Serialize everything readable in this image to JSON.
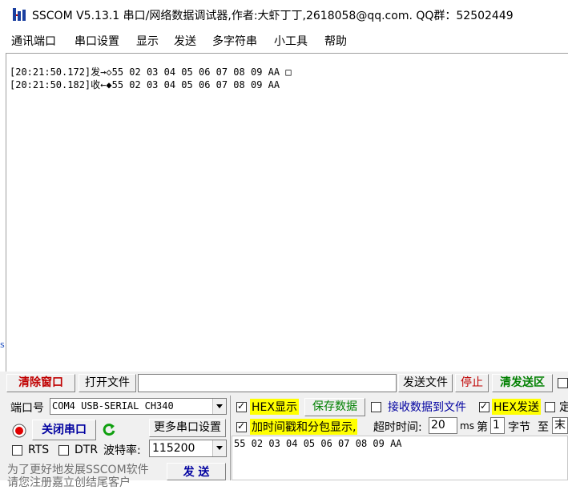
{
  "window": {
    "title": "SSCOM V5.13.1 串口/网络数据调试器,作者:大虾丁丁,2618058@qq.com. QQ群：52502449",
    "icon": "sscom-app-icon"
  },
  "menu": {
    "items": [
      {
        "label": "通讯端口"
      },
      {
        "label": "串口设置"
      },
      {
        "label": "显示"
      },
      {
        "label": "发送"
      },
      {
        "label": "多字符串"
      },
      {
        "label": "小工具"
      },
      {
        "label": "帮助"
      }
    ]
  },
  "receive": {
    "lines": [
      "[20:21:50.172]发→◇55 02 03 04 05 06 07 08 09 AA □",
      "[20:21:50.182]收←◆55 02 03 04 05 06 07 08 09 AA"
    ]
  },
  "left_tag": "s",
  "toolbar": {
    "clear_window": "清除窗口",
    "open_file": "打开文件",
    "file_path": "",
    "send_file": "发送文件",
    "stop": "停止",
    "clear_send": "清发送区"
  },
  "port": {
    "label": "端口号",
    "value": "COM4 USB-SERIAL CH340",
    "close_button": "关闭串口",
    "more_settings": "更多串口设置",
    "rts_label": "RTS",
    "dtr_label": "DTR",
    "baud_label": "波特率:",
    "baud_value": "115200"
  },
  "options": {
    "hex_display": "HEX显示",
    "save_data": "保存数据",
    "recv_to_file": "接收数据到文件",
    "hex_send": "HEX发送",
    "timed_label": "定",
    "timestamp": "加时间戳和分包显示,",
    "timeout_label": "超时时间:",
    "timeout_value": "20",
    "ms": "ms",
    "di": "第",
    "byte_from": "1",
    "byte_label": "字节",
    "to": "至",
    "to_value": "末"
  },
  "send": {
    "data": "55 02 03 04 05 06 07 08 09 AA",
    "send_button": "发 送"
  },
  "promo": {
    "line1": "为了更好地发展SSCOM软件",
    "line2": "请您注册嘉立创结尾客户"
  },
  "colors": {
    "highlight": "#ffff00",
    "clear_red": "#c00000",
    "close_blue": "#0000a0",
    "save_green": "#008000"
  }
}
